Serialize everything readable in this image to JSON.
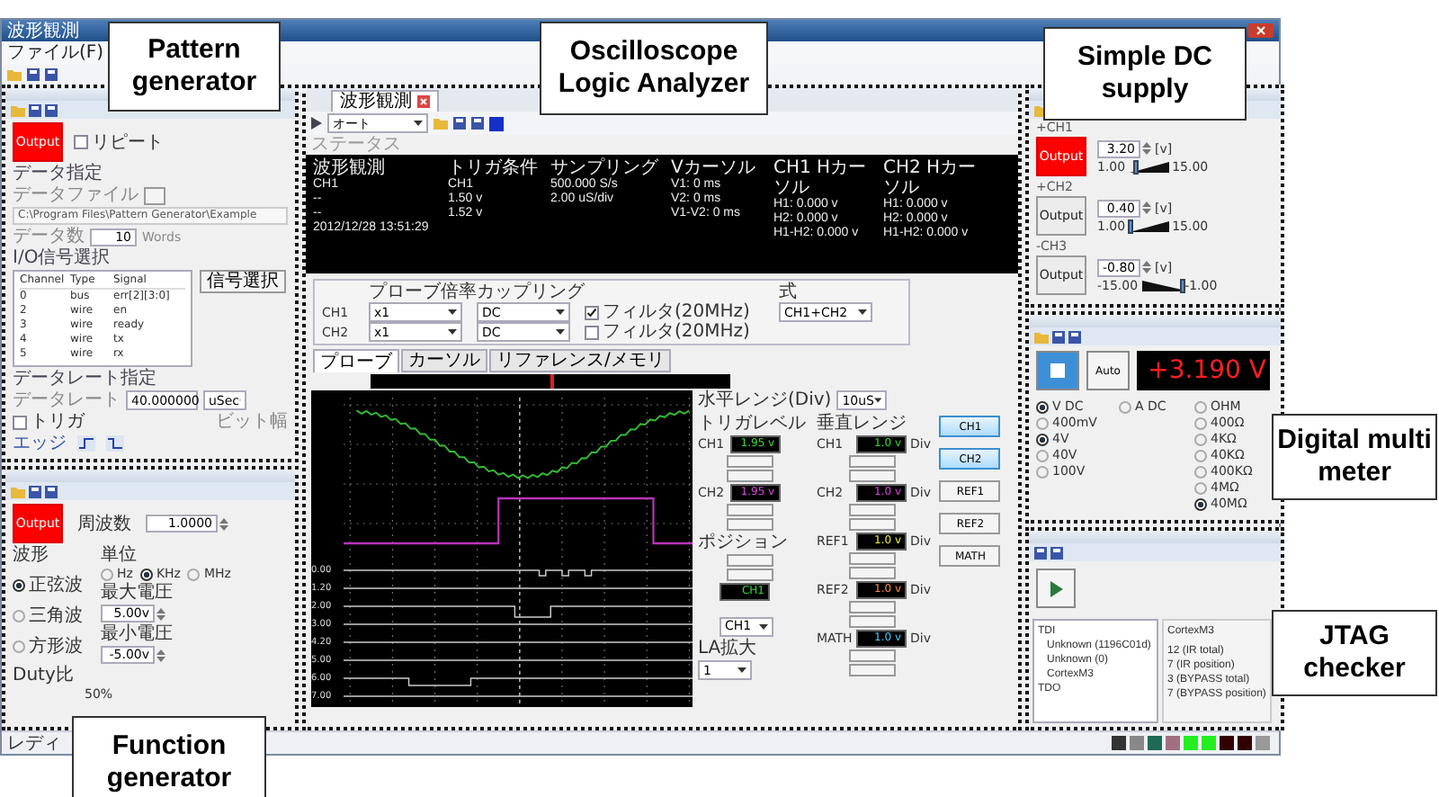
{
  "window": {
    "title": "波形観測",
    "menu": [
      "ファイル(F)"
    ],
    "status": "レディ"
  },
  "callouts": [
    {
      "lines": [
        "Pattern",
        "generator"
      ]
    },
    {
      "lines": [
        "Oscilloscope",
        "Logic Analyzer"
      ]
    },
    {
      "lines": [
        "Simple DC",
        "supply"
      ]
    },
    {
      "lines": [
        "Digital multi",
        "meter"
      ]
    },
    {
      "lines": [
        "JTAG",
        "checker"
      ]
    },
    {
      "lines": [
        "Function",
        "generator"
      ]
    }
  ],
  "pattern_generator": {
    "output": {
      "label": "Output",
      "on": true
    },
    "repeat": {
      "label": "リピート",
      "checked": false
    },
    "data_section": "データ指定",
    "file_label": "データファイル",
    "file_path": "C:\\Program Files\\Pattern Generator\\Example",
    "count_label": "データ数",
    "count": "10",
    "count_unit": "Words",
    "io_section": "I/O信号選択",
    "select_button": "信号選択",
    "columns": [
      "Channel",
      "Type",
      "Signal"
    ],
    "rows": [
      [
        "0",
        "bus",
        "err[2][3:0]"
      ],
      [
        "2",
        "wire",
        "en"
      ],
      [
        "3",
        "wire",
        "ready"
      ],
      [
        "4",
        "wire",
        "tx"
      ],
      [
        "5",
        "wire",
        "rx"
      ]
    ],
    "rate_section": "データレート指定",
    "rate_label": "データレート",
    "rate": "40.000000",
    "rate_unit": "uSec",
    "bit_label": "ビット幅",
    "trigger": {
      "label": "トリガ",
      "checked": false
    },
    "edge_label": "エッジ"
  },
  "function_generator": {
    "output": {
      "label": "Output",
      "on": true
    },
    "freq_label": "周波数",
    "freq": "1.0000",
    "wave_label": "波形",
    "waves": [
      {
        "label": "正弦波",
        "selected": true
      },
      {
        "label": "三角波",
        "selected": false
      },
      {
        "label": "方形波",
        "selected": false
      }
    ],
    "unit_label": "単位",
    "units": [
      {
        "label": "Hz",
        "selected": false
      },
      {
        "label": "KHz",
        "selected": true
      },
      {
        "label": "MHz",
        "selected": false
      }
    ],
    "max_label": "最大電圧",
    "max": "5.00v",
    "min_label": "最小電圧",
    "min": "-5.00v",
    "duty_label": "Duty比",
    "duty": "50%"
  },
  "oscilloscope": {
    "tab": "波形観測",
    "mode": "オート",
    "status_label": "ステータス",
    "status_columns": [
      {
        "title": "波形観測",
        "rows": [
          "CH1",
          "--",
          "--",
          "2012/12/28 13:51:29"
        ]
      },
      {
        "title": "トリガ条件",
        "rows": [
          "CH1",
          "1.50 v",
          "1.52 v"
        ]
      },
      {
        "title": "サンプリング",
        "rows": [
          "500.000 S/s",
          "2.00 uS/div"
        ]
      },
      {
        "title": "Vカーソル",
        "rows": [
          "V1:  0 ms",
          "V2:  0 ms",
          "V1-V2:  0 ms"
        ]
      },
      {
        "title": "CH1 Hカーソル",
        "rows": [
          "H1:  0.000 v",
          "H2:  0.000 v",
          "H1-H2:  0.000 v"
        ]
      },
      {
        "title": "CH2 Hカーソル",
        "rows": [
          "H1:  0.000 v",
          "H2:  0.000 v",
          "H1-H2:  0.000 v"
        ]
      }
    ],
    "probe_header": "プローブ倍率",
    "coupling_header": "カップリング",
    "expr_header": "式",
    "channels": [
      {
        "name": "CH1",
        "probe": "x1",
        "coupling": "DC",
        "filter": {
          "label": "フィルタ(20MHz)",
          "checked": true
        },
        "expr": "CH1+CH2"
      },
      {
        "name": "CH2",
        "probe": "x1",
        "coupling": "DC",
        "filter": {
          "label": "フィルタ(20MHz)",
          "checked": false
        }
      }
    ],
    "tabs": [
      {
        "label": "プローブ",
        "selected": true
      },
      {
        "label": "カーソル",
        "selected": false
      },
      {
        "label": "リファレンス/メモリ",
        "selected": false
      }
    ],
    "logic_labels": [
      "0.00",
      "1.20",
      "2.00",
      "3.00",
      "4.20",
      "5.00",
      "6.00",
      "7.00"
    ],
    "hrange_label": "水平レンジ(Div)",
    "hrange": "10uS",
    "trigger_label": "トリガレベル",
    "trigger_levels": [
      {
        "name": "CH1",
        "value": "1.95 v",
        "color": "#33dd33"
      },
      {
        "name": "CH2",
        "value": "1.95 v",
        "color": "#dd44dd"
      }
    ],
    "position_label": "ポジション",
    "position_display": "CH1",
    "position_select": "CH1",
    "la_label": "LA拡大",
    "la": "1",
    "vrange_label": "垂直レンジ",
    "vranges": [
      {
        "name": "CH1",
        "value": "1.0 v",
        "unit": "Div",
        "color": "#33dd33"
      },
      {
        "name": "CH2",
        "value": "1.0 v",
        "unit": "Div",
        "color": "#dd44dd"
      },
      {
        "name": "REF1",
        "value": "1.0 v",
        "unit": "Div",
        "color": "#eeee33"
      },
      {
        "name": "REF2",
        "value": "1.0 v",
        "unit": "Div",
        "color": "#ff8844"
      },
      {
        "name": "MATH",
        "value": "1.0 v",
        "unit": "Div",
        "color": "#44ccff"
      }
    ],
    "buttons": [
      {
        "label": "CH1",
        "selected": true
      },
      {
        "label": "CH2",
        "selected": true
      },
      {
        "label": "REF1",
        "selected": false
      },
      {
        "label": "REF2",
        "selected": false
      },
      {
        "label": "MATH",
        "selected": false
      }
    ]
  },
  "dc_supply": {
    "channels": [
      {
        "label": "+CH1",
        "kind": "positive",
        "output": {
          "label": "Output",
          "on": true
        },
        "value": "3.20",
        "unit": "[v]",
        "min": "1.00",
        "max": "15.00",
        "level": 0.16
      },
      {
        "label": "+CH2",
        "kind": "positive",
        "output": {
          "label": "Output",
          "on": false
        },
        "value": "0.40",
        "unit": "[v]",
        "min": "1.00",
        "max": "15.00",
        "level": 0
      },
      {
        "label": "-CH3",
        "kind": "negative",
        "output": {
          "label": "Output",
          "on": false
        },
        "value": "-0.80",
        "unit": "[v]",
        "min": "-15.00",
        "max": "-1.00",
        "level": 1
      }
    ]
  },
  "dmm": {
    "auto": "Auto",
    "reading": "+3.190 V",
    "modes": [
      {
        "label": "V DC",
        "selected": true
      },
      {
        "label": "A DC",
        "selected": false
      },
      {
        "label": "OHM",
        "selected": false
      }
    ],
    "v_ranges": [
      {
        "label": "400mV",
        "selected": false
      },
      {
        "label": "4V",
        "selected": true
      },
      {
        "label": "40V",
        "selected": false
      },
      {
        "label": "100V",
        "selected": false
      }
    ],
    "ohm_ranges": [
      {
        "label": "400Ω",
        "selected": false
      },
      {
        "label": "4KΩ",
        "selected": false
      },
      {
        "label": "40KΩ",
        "selected": false
      },
      {
        "label": "400KΩ",
        "selected": false
      },
      {
        "label": "4MΩ",
        "selected": false
      },
      {
        "label": "40MΩ",
        "selected": true
      }
    ]
  },
  "jtag": {
    "tree": [
      {
        "label": "TDI",
        "children": [
          {
            "label": "Unknown (1196C01d)"
          },
          {
            "label": "Unknown (0)"
          },
          {
            "label": "CortexM3"
          }
        ]
      },
      {
        "label": "TDO"
      }
    ],
    "info_title": "CortexM3",
    "info": [
      "12 (IR total)",
      "7 (IR position)",
      "3 (BYPASS total)",
      "7 (BYPASS position)"
    ]
  }
}
